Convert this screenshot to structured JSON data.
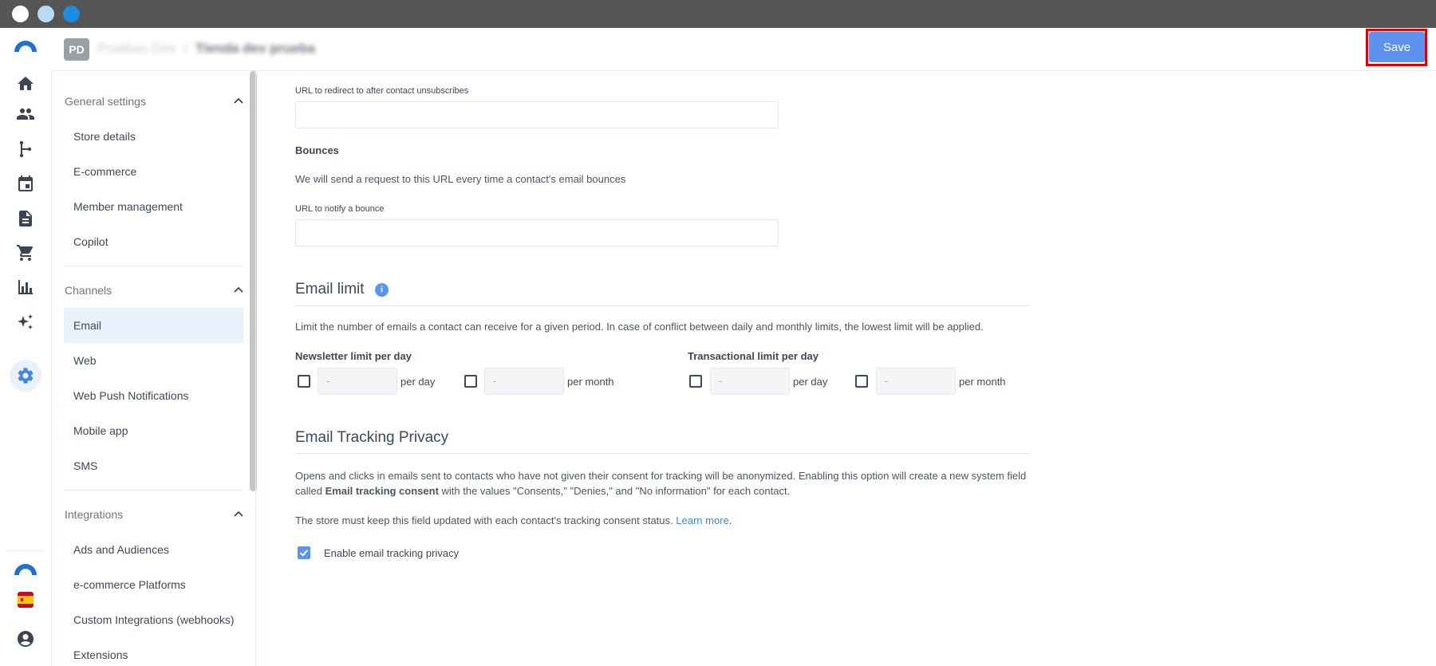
{
  "window": {
    "title": ""
  },
  "header": {
    "avatar_initials": "PD",
    "breadcrumb_account": "Pruebas Dev",
    "breadcrumb_separator": "/",
    "breadcrumb_store": "Tienda dev prueba",
    "save_label": "Save"
  },
  "rail": {
    "items": [
      "logo-icon",
      "home-icon",
      "contacts-icon",
      "flows-icon",
      "calendar-icon",
      "document-icon",
      "cart-icon",
      "analytics-icon",
      "sparkle-icon",
      "settings-icon"
    ],
    "active": "settings-icon",
    "bottom": [
      "logo-icon",
      "spain-flag-icon",
      "account-icon"
    ]
  },
  "sidebar": {
    "sections": [
      {
        "title": "General settings",
        "items": [
          "Store details",
          "E-commerce",
          "Member management",
          "Copilot"
        ]
      },
      {
        "title": "Channels",
        "items": [
          "Email",
          "Web",
          "Web Push Notifications",
          "Mobile app",
          "SMS"
        ]
      },
      {
        "title": "Integrations",
        "items": [
          "Ads and Audiences",
          "e-commerce Platforms",
          "Custom Integrations (webhooks)",
          "Extensions"
        ]
      }
    ],
    "active_item": "Email"
  },
  "main": {
    "unsubscribe_url_label": "URL to redirect to after contact unsubscribes",
    "unsubscribe_url_value": "",
    "bounces_title": "Bounces",
    "bounces_description": "We will send a request to this URL every time a contact's email bounces",
    "bounce_url_label": "URL to notify a bounce",
    "bounce_url_value": "",
    "email_limit": {
      "title": "Email limit",
      "description": "Limit the number of emails a contact can receive for a given period. In case of conflict between daily and monthly limits, the lowest limit will be applied.",
      "newsletter_label": "Newsletter limit per day",
      "transactional_label": "Transactional limit per day",
      "placeholder": "-",
      "per_day": "per day",
      "per_month": "per month"
    },
    "tracking": {
      "title": "Email Tracking Privacy",
      "desc_part1": "Opens and clicks in emails sent to contacts who have not given their consent for tracking will be anonymized. Enabling this option will create a new system field called ",
      "desc_bold": "Email tracking consent",
      "desc_part2": " with the values \"Consents,\" \"Denies,\" and \"No information\" for each contact.",
      "keep_text": "The store must keep this field updated with each contact's tracking consent status.",
      "learn_more": "Learn more",
      "learn_more_suffix": ".",
      "checkbox_label": "Enable email tracking privacy",
      "checkbox_checked": true
    }
  },
  "colors": {
    "accent": "#5b93ef",
    "highlight": "#e00000",
    "active_bg": "#e8f2fd"
  }
}
